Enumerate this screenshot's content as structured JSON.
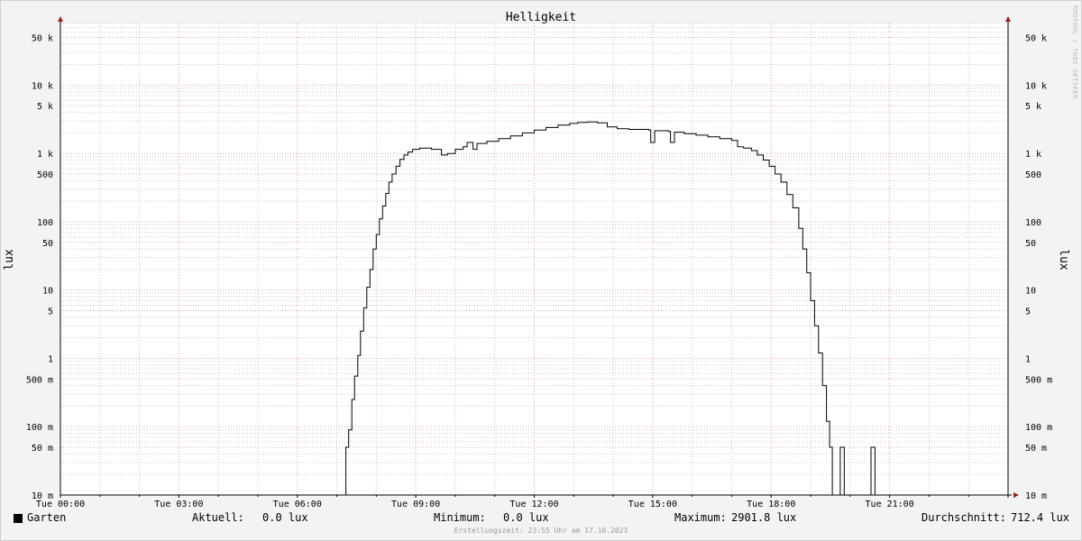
{
  "chart_data": {
    "type": "line",
    "title": "Helligkeit",
    "ylabel": "lux",
    "y_scale": "log",
    "ylim": [
      0.01,
      80000
    ],
    "xlim": [
      0,
      24
    ],
    "x_ticks": [
      {
        "x": 0,
        "label": "Tue 00:00"
      },
      {
        "x": 3,
        "label": "Tue 03:00"
      },
      {
        "x": 6,
        "label": "Tue 06:00"
      },
      {
        "x": 9,
        "label": "Tue 09:00"
      },
      {
        "x": 12,
        "label": "Tue 12:00"
      },
      {
        "x": 15,
        "label": "Tue 15:00"
      },
      {
        "x": 18,
        "label": "Tue 18:00"
      },
      {
        "x": 21,
        "label": "Tue 21:00"
      }
    ],
    "y_ticks": [
      {
        "v": 0.01,
        "label": "10 m"
      },
      {
        "v": 0.05,
        "label": "50 m"
      },
      {
        "v": 0.1,
        "label": "100 m"
      },
      {
        "v": 0.5,
        "label": "500 m"
      },
      {
        "v": 1,
        "label": "1"
      },
      {
        "v": 5,
        "label": "5"
      },
      {
        "v": 10,
        "label": "10"
      },
      {
        "v": 50,
        "label": "50"
      },
      {
        "v": 100,
        "label": "100"
      },
      {
        "v": 500,
        "label": "500"
      },
      {
        "v": 1000,
        "label": "1 k"
      },
      {
        "v": 5000,
        "label": "5 k"
      },
      {
        "v": 10000,
        "label": "10 k"
      },
      {
        "v": 50000,
        "label": "50 k"
      }
    ],
    "grid": true,
    "series": [
      {
        "name": "Garten",
        "color": "#000000",
        "points": [
          [
            0,
            0.01
          ],
          [
            7.2,
            0.01
          ],
          [
            7.23,
            0.05
          ],
          [
            7.3,
            0.09
          ],
          [
            7.38,
            0.25
          ],
          [
            7.45,
            0.55
          ],
          [
            7.53,
            1.1
          ],
          [
            7.6,
            2.5
          ],
          [
            7.68,
            5.5
          ],
          [
            7.76,
            11
          ],
          [
            7.84,
            20
          ],
          [
            7.92,
            40
          ],
          [
            8.0,
            65
          ],
          [
            8.08,
            110
          ],
          [
            8.16,
            170
          ],
          [
            8.24,
            260
          ],
          [
            8.32,
            380
          ],
          [
            8.4,
            500
          ],
          [
            8.5,
            650
          ],
          [
            8.6,
            820
          ],
          [
            8.7,
            950
          ],
          [
            8.8,
            1050
          ],
          [
            8.92,
            1150
          ],
          [
            9.1,
            1200
          ],
          [
            9.4,
            1150
          ],
          [
            9.65,
            950
          ],
          [
            9.8,
            1000
          ],
          [
            10.0,
            1150
          ],
          [
            10.2,
            1250
          ],
          [
            10.3,
            1450
          ],
          [
            10.45,
            1150
          ],
          [
            10.55,
            1400
          ],
          [
            10.8,
            1500
          ],
          [
            11.1,
            1650
          ],
          [
            11.4,
            1800
          ],
          [
            11.7,
            2000
          ],
          [
            12.0,
            2200
          ],
          [
            12.3,
            2400
          ],
          [
            12.6,
            2600
          ],
          [
            12.9,
            2750
          ],
          [
            13.1,
            2850
          ],
          [
            13.35,
            2900
          ],
          [
            13.6,
            2800
          ],
          [
            13.85,
            2450
          ],
          [
            14.1,
            2300
          ],
          [
            14.4,
            2250
          ],
          [
            14.9,
            2200
          ],
          [
            14.95,
            1450
          ],
          [
            15.05,
            2150
          ],
          [
            15.4,
            2100
          ],
          [
            15.45,
            1450
          ],
          [
            15.55,
            2050
          ],
          [
            15.8,
            1950
          ],
          [
            16.1,
            1850
          ],
          [
            16.4,
            1750
          ],
          [
            16.7,
            1650
          ],
          [
            17.0,
            1550
          ],
          [
            17.15,
            1250
          ],
          [
            17.3,
            1200
          ],
          [
            17.5,
            1100
          ],
          [
            17.65,
            950
          ],
          [
            17.8,
            800
          ],
          [
            17.95,
            650
          ],
          [
            18.1,
            500
          ],
          [
            18.25,
            380
          ],
          [
            18.4,
            250
          ],
          [
            18.55,
            160
          ],
          [
            18.7,
            80
          ],
          [
            18.8,
            40
          ],
          [
            18.9,
            18
          ],
          [
            19.0,
            7
          ],
          [
            19.1,
            3
          ],
          [
            19.2,
            1.2
          ],
          [
            19.3,
            0.4
          ],
          [
            19.4,
            0.12
          ],
          [
            19.48,
            0.05
          ],
          [
            19.55,
            0.01
          ],
          [
            19.72,
            0.01
          ],
          [
            19.75,
            0.05
          ],
          [
            19.82,
            0.05
          ],
          [
            19.85,
            0.01
          ],
          [
            20.5,
            0.01
          ],
          [
            20.53,
            0.05
          ],
          [
            20.6,
            0.05
          ],
          [
            20.63,
            0.01
          ],
          [
            24.0,
            0.01
          ]
        ]
      }
    ]
  },
  "legend": {
    "name": "Garten",
    "current_label": "Aktuell:",
    "current_value": "0.0 lux",
    "min_label": "Minimum:",
    "min_value": "0.0 lux",
    "max_label": "Maximum:",
    "max_value": "2901.8 lux",
    "avg_label": "Durchschnitt:",
    "avg_value": "712.4 lux"
  },
  "created_text": "Erstellungszeit: 23:55 Uhr am 17.10.2023",
  "watermark": "RRDTOOL / TOBI OETIKER",
  "colors": {
    "background": "#f3f3f3",
    "canvas": "#ffffff",
    "major_grid": "#e8a0a8",
    "minor_grid": "#c8c8c8",
    "axis": "#000000",
    "arrow": "#9b1a1a",
    "line": "#000000"
  }
}
